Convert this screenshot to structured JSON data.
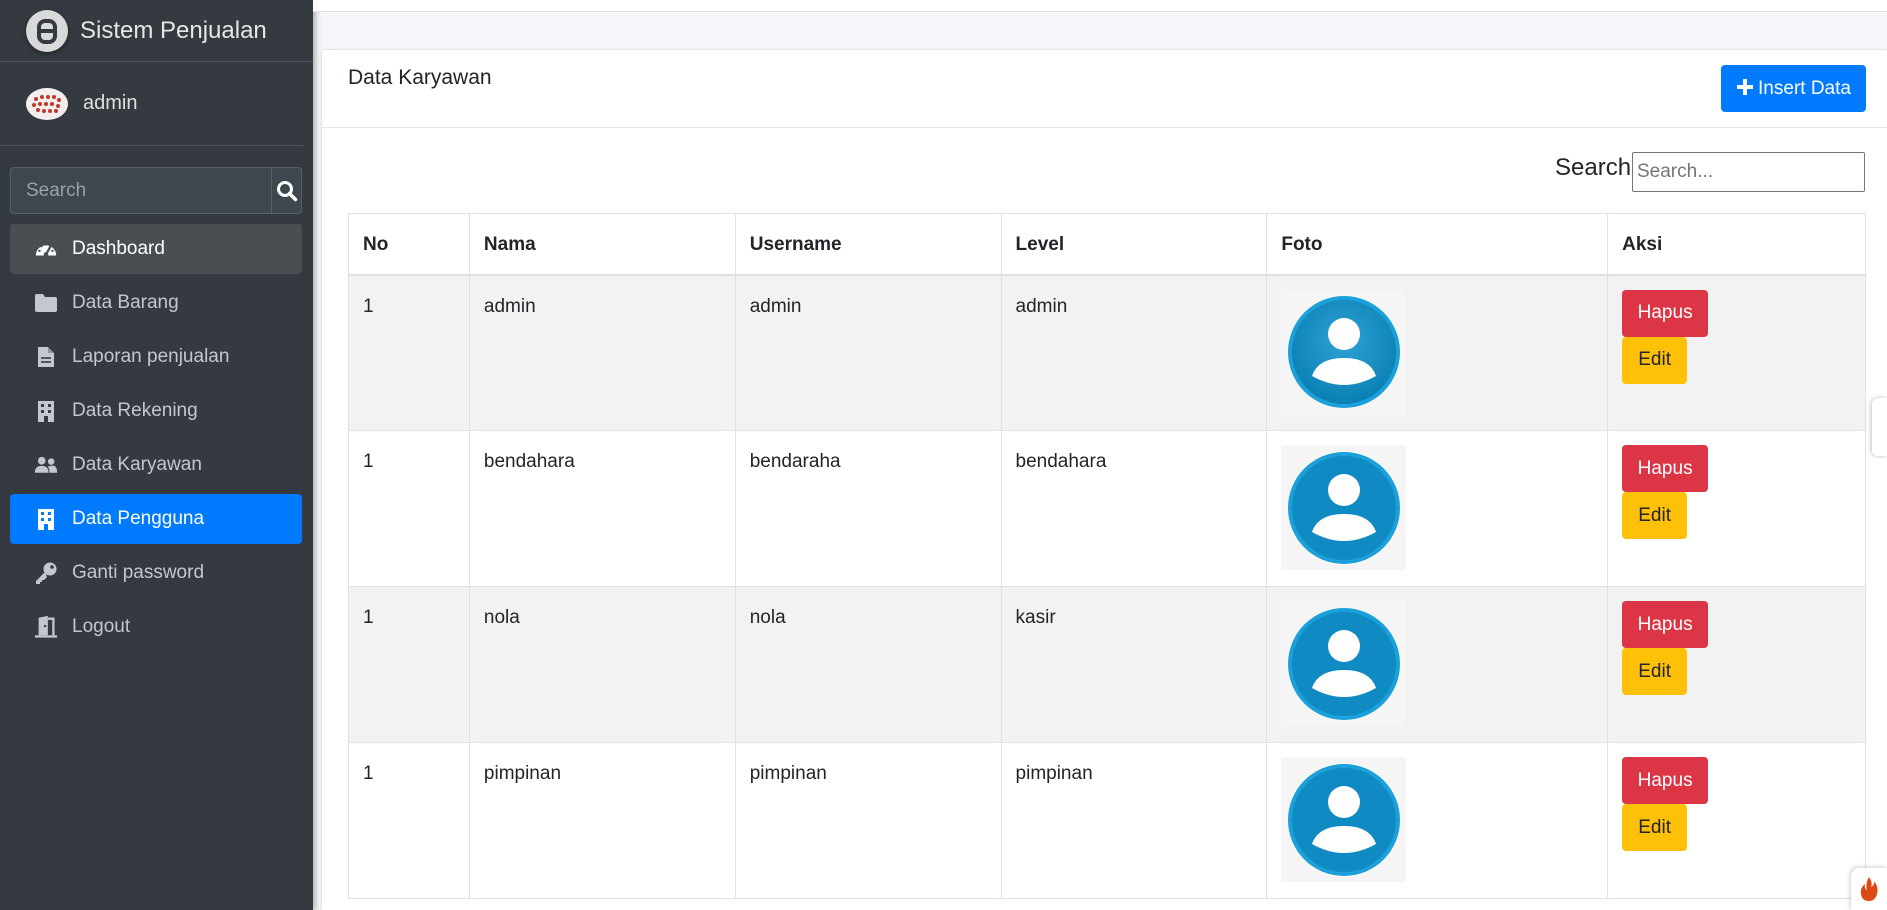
{
  "brand": {
    "title": "Sistem Penjualan"
  },
  "user": {
    "name": "admin"
  },
  "sidebar_search": {
    "placeholder": "Search"
  },
  "nav": [
    {
      "label": "Dashboard",
      "icon": "tachometer-icon"
    },
    {
      "label": "Data Barang",
      "icon": "folder-icon"
    },
    {
      "label": "Laporan penjualan",
      "icon": "file-icon"
    },
    {
      "label": "Data Rekening",
      "icon": "building-icon"
    },
    {
      "label": "Data Karyawan",
      "icon": "users-icon"
    },
    {
      "label": "Data Pengguna",
      "icon": "building-icon"
    },
    {
      "label": "Ganti password",
      "icon": "key-icon"
    },
    {
      "label": "Logout",
      "icon": "door-icon"
    }
  ],
  "card": {
    "title": "Data Karyawan",
    "insert_label": "Insert Data",
    "search_label": "Search:",
    "search_placeholder": "Search..."
  },
  "table": {
    "headers": [
      "No",
      "Nama",
      "Username",
      "Level",
      "Foto",
      "Aksi"
    ],
    "rows": [
      {
        "no": "1",
        "nama": "admin",
        "username": "admin",
        "level": "admin"
      },
      {
        "no": "1",
        "nama": "bendahara",
        "username": "bendaraha",
        "level": "bendahara"
      },
      {
        "no": "1",
        "nama": "nola",
        "username": "nola",
        "level": "kasir"
      },
      {
        "no": "1",
        "nama": "pimpinan",
        "username": "pimpinan",
        "level": "pimpinan"
      }
    ],
    "delete_label": "Hapus",
    "edit_label": "Edit"
  },
  "colors": {
    "sidebar_bg": "#343a40",
    "active": "#007bff",
    "danger": "#dc3545",
    "warning": "#ffc107"
  }
}
